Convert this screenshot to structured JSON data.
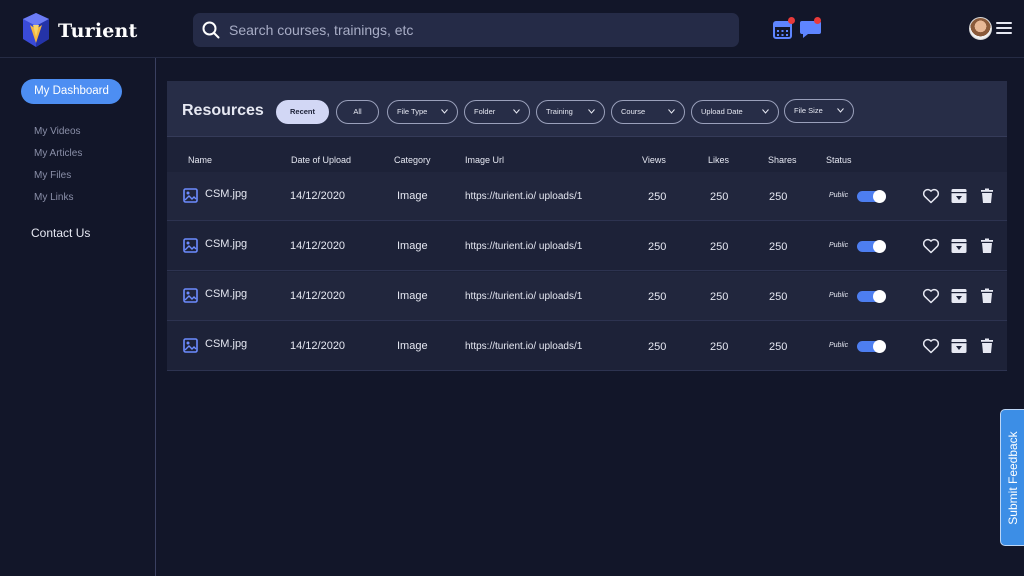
{
  "app": {
    "brand": "Turient"
  },
  "search": {
    "placeholder": "Search courses, trainings, etc"
  },
  "colors": {
    "background": "#121629",
    "accent": "#4d8ef2",
    "card": "#1d2238",
    "notification": "#e83a3a"
  },
  "sidebar": {
    "dashboard_label": "My Dashboard",
    "links": [
      "My Videos",
      "My Articles",
      "My Files",
      "My Links"
    ],
    "contact_label": "Contact Us"
  },
  "resources": {
    "title": "Resources",
    "filters": [
      "Recent",
      "All",
      "File Type",
      "Folder",
      "Training",
      "Course",
      "Upload Date",
      "File Size"
    ],
    "columns": [
      "Name",
      "Date of  Upload",
      "Category",
      "Image Url",
      "Views",
      "Likes",
      "Shares",
      "Status"
    ],
    "rows": [
      {
        "name": "CSM.jpg",
        "date": "14/12/2020",
        "category": "Image",
        "url": "https://turient.io/ uploads/1",
        "views": "250",
        "likes": "250",
        "shares": "250",
        "status": "Public"
      },
      {
        "name": "CSM.jpg",
        "date": "14/12/2020",
        "category": "Image",
        "url": "https://turient.io/ uploads/1",
        "views": "250",
        "likes": "250",
        "shares": "250",
        "status": "Public"
      },
      {
        "name": "CSM.jpg",
        "date": "14/12/2020",
        "category": "Image",
        "url": "https://turient.io/ uploads/1",
        "views": "250",
        "likes": "250",
        "shares": "250",
        "status": "Public"
      },
      {
        "name": "CSM.jpg",
        "date": "14/12/2020",
        "category": "Image",
        "url": "https://turient.io/ uploads/1",
        "views": "250",
        "likes": "250",
        "shares": "250",
        "status": "Public"
      }
    ],
    "icons": {
      "file": "image-icon",
      "like": "heart-icon",
      "archive": "archive-icon",
      "delete": "trash-icon"
    }
  },
  "feedback": {
    "label": "Submit Feedback"
  }
}
